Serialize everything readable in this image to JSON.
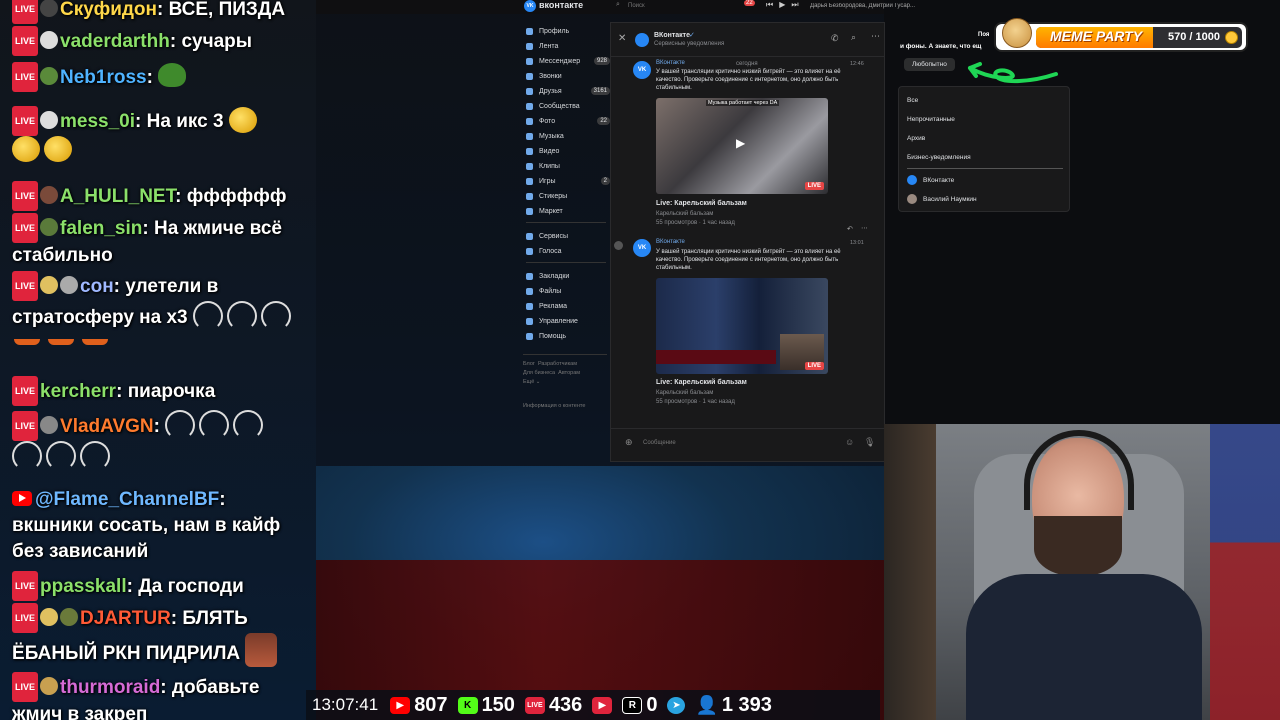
{
  "chat": {
    "messages": [
      {
        "nick": "Скуфидон",
        "text": "ВСЕ, ПИЗДА",
        "nick_color": "#ffd84a"
      },
      {
        "nick": "vaderdarthh",
        "text": "сучары",
        "nick_color": "#8be06a"
      },
      {
        "nick": "Neb1ross",
        "text": "",
        "nick_color": "#4fb3ff"
      },
      {
        "nick": "mess_0i",
        "text": "На икс 3",
        "nick_color": "#8be06a"
      },
      {
        "nick": "A_HULI_NET",
        "text": "фффффф",
        "nick_color": "#8be06a"
      },
      {
        "nick": "falen_sin",
        "text": "На жмиче всё стабильно",
        "nick_color": "#8be06a"
      },
      {
        "nick": "сон",
        "text": "улетели в стратосферу на х3",
        "nick_color": "#9fb8ff"
      },
      {
        "nick": "kercherr",
        "text": "пиарочка",
        "nick_color": "#8be06a"
      },
      {
        "nick": "VladAVGN",
        "text": "",
        "nick_color": "#ff7b2e"
      },
      {
        "nick": "@Flame_ChannelBF",
        "text": "вкшники сосать, нам в кайф без зависаний",
        "nick_color": "#6fb8ff"
      },
      {
        "nick": "ppasskall",
        "text": "Да господи",
        "nick_color": "#8be06a"
      },
      {
        "nick": "DJARTUR",
        "text": "БЛЯТЬ ЁБАНЫЙ РКН ПИДРИЛА",
        "nick_color": "#ff5a36"
      },
      {
        "nick": "thurmoraid",
        "text": "добавьте жмич в закреп",
        "nick_color": "#d66bd6"
      }
    ],
    "badge_live": "LIVE"
  },
  "vk": {
    "brand": "вконтакте",
    "search_placeholder": "Поиск",
    "top_users": "Дарья Безбородова, Дмитрий Гусар...",
    "top_badge": "22",
    "sidebar": [
      {
        "label": "Профиль",
        "count": ""
      },
      {
        "label": "Лента",
        "count": ""
      },
      {
        "label": "Мессенджер",
        "count": "928"
      },
      {
        "label": "Звонки",
        "count": ""
      },
      {
        "label": "Друзья",
        "count": "3161"
      },
      {
        "label": "Сообщества",
        "count": ""
      },
      {
        "label": "Фото",
        "count": "22"
      },
      {
        "label": "Музыка",
        "count": ""
      },
      {
        "label": "Видео",
        "count": ""
      },
      {
        "label": "Клипы",
        "count": ""
      },
      {
        "label": "Игры",
        "count": "2"
      },
      {
        "label": "Стикеры",
        "count": ""
      },
      {
        "label": "Маркет",
        "count": ""
      },
      {
        "label": "Сервисы",
        "count": ""
      },
      {
        "label": "Голоса",
        "count": ""
      },
      {
        "label": "Закладки",
        "count": ""
      },
      {
        "label": "Файлы",
        "count": ""
      },
      {
        "label": "Реклама",
        "count": ""
      },
      {
        "label": "Управление",
        "count": ""
      },
      {
        "label": "Помощь",
        "count": ""
      }
    ],
    "footer_links": "Блог  Разработчикам\nДля бизнеса  Авторам\nЕщё ⌄",
    "footer_info": "Информация о контенте",
    "chat_name": "ВКонтакте",
    "chat_sub": "Сервисные уведомления",
    "date_sep": "сегодня",
    "posts": [
      {
        "sender": "ВКонтакте",
        "time": "12:46",
        "text": "У вашей трансляции критично низкий битрейт — это влияет на её качество. Проверьте соединение с интернетом, оно должно быть стабильным.",
        "thumb_caption": "Музыка работает через DA",
        "title": "Live: Карельский бальзам",
        "channel": "Карельский бальзам",
        "meta": "55 просмотров · 1 час назад",
        "live": "LIVE"
      },
      {
        "sender": "ВКонтакте",
        "time": "13:01",
        "text": "У вашей трансляции критично низкий битрейт — это влияет на её качество. Проверьте соединение с интернетом, оно должно быть стабильным.",
        "thumb_caption": "",
        "title": "Live: Карельский бальзам",
        "channel": "Карельский бальзам",
        "meta": "55 просмотров · 1 час назад",
        "live": "LIVE"
      }
    ],
    "compose_placeholder": "Сообщение",
    "right_top_text": "и фоны. А знаете, что ещ",
    "right_top_word": "Поя",
    "right_button": "Любопытно",
    "filters": [
      "Все",
      "Непрочитанные",
      "Архив",
      "Бизнес-уведомления"
    ],
    "contacts": [
      "ВКонтакте",
      "Василий Наумкин"
    ]
  },
  "stats": {
    "time": "13:07:41",
    "youtube": "807",
    "kick": "150",
    "vklive": "436",
    "rutube": "0",
    "rutube_label": "0",
    "telegram": "1 393",
    "youtube_icon": "youtube-icon",
    "kick_icon": "kick-icon"
  },
  "meme_party": {
    "title": "MEME PARTY",
    "progress": "570 / 1000",
    "fraction": 0.57
  },
  "colors": {
    "vk_blue": "#2787f5",
    "live_red": "#e0243c",
    "accent_orange": "#ff9a00"
  }
}
